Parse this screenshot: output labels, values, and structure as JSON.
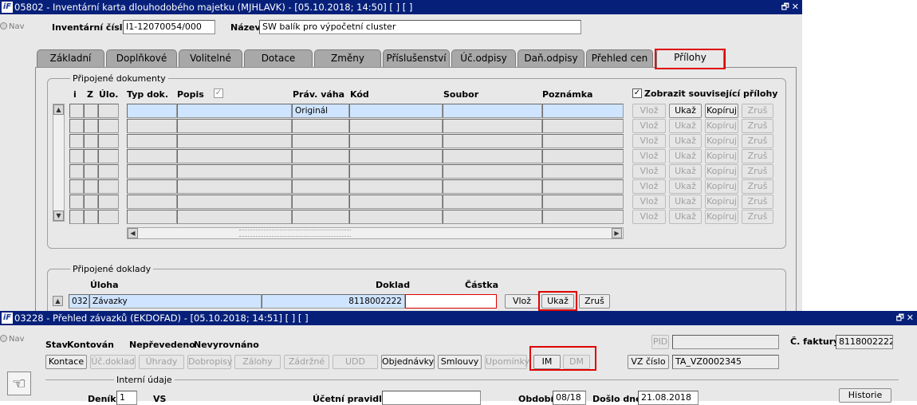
{
  "window1": {
    "title": "05802 - Inventární karta dlouhodobého majetku (MJHLAVK) - [05.10.2018; 14:50]  [ ]  [ ]",
    "nav_label": "Nav",
    "inventory_number_label": "Inventární číslo",
    "inventory_number_value": "I1-12070054/000",
    "name_label": "Název",
    "name_value": "SW balík pro výpočetní cluster",
    "tabs": [
      "Základní",
      "Doplňkové",
      "Volitelné",
      "Dotace",
      "Změny",
      "Příslušenství",
      "Úč.odpisy",
      "Daň.odpisy",
      "Přehled cen",
      "Přílohy"
    ],
    "attached_documents": {
      "legend": "Připojené dokumenty",
      "columns": {
        "i": "i",
        "z": "Z",
        "ulo": "Úlo.",
        "typ": "Typ dok.",
        "popis": "Popis",
        "prav": "Práv. váha",
        "kod": "Kód",
        "soubor": "Soubor",
        "poznamka": "Poznámka"
      },
      "first_row_prav": "Originál",
      "show_related_label": "Zobrazit související přílohy",
      "buttons": {
        "insert": "Vlož",
        "show": "Ukaž",
        "copy": "Kopíruj",
        "cancel": "Zruš"
      }
    },
    "attached_records": {
      "legend": "Připojené doklady",
      "columns": {
        "task": "Úloha",
        "doc": "Doklad",
        "amount": "Částka"
      },
      "row": {
        "code": "032",
        "task": "Závazky",
        "doc": "8118002222",
        "amount": ""
      },
      "buttons": {
        "insert": "Vlož",
        "show": "Ukaž",
        "cancel": "Zruš"
      }
    }
  },
  "window2": {
    "title": "03228 - Přehled závazků (EKDOFAD) - [05.10.2018; 14:51]  [ ]  [ ]",
    "nav_label": "Nav",
    "status_label": "Stav",
    "status_values": [
      "Kontován",
      "Nepřevedeno",
      "Nevyrovnáno"
    ],
    "pid_label": "PID",
    "invoice_label": "Č. faktury",
    "invoice_value": "8118002222",
    "buttons": [
      "Kontace",
      "Úč.doklad",
      "Úhrady",
      "Dobropisy",
      "Zálohy",
      "Zádržné",
      "UDD",
      "Objednávky",
      "Smlouvy",
      "Upomínky",
      "IM",
      "DM"
    ],
    "vz_button": "VZ číslo",
    "vz_value": "TA_VZ0002345",
    "internal_data_label": "Interní údaje",
    "journal_label": "Deník",
    "journal_value": "1",
    "vs_label": "VS",
    "accounting_rule_label": "Účetní pravidlo",
    "period_label": "Období",
    "period_value": "08/18",
    "received_label": "Došlo dne",
    "received_value": "21.08.2018",
    "history_button": "Historie"
  },
  "colors": {
    "titlebar": "#06207a",
    "highlight": "#e00000",
    "selected_cell": "#cfe4ff",
    "form_bg": "#e8e8e8"
  }
}
